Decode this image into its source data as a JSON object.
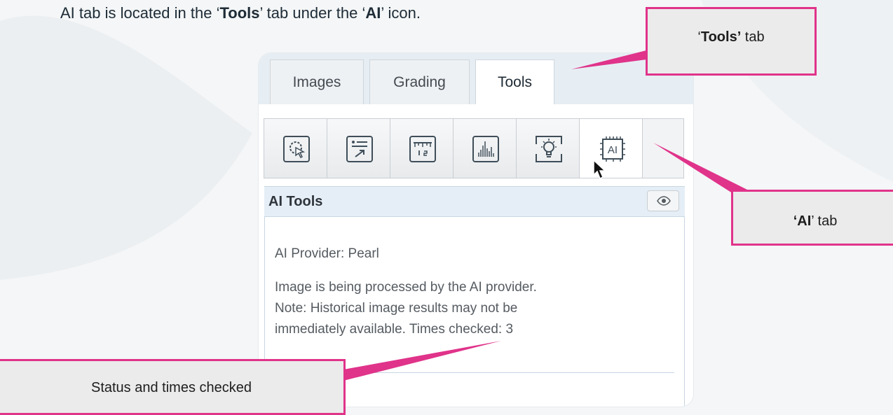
{
  "heading": {
    "prefix": "AI tab is located in the ‘",
    "tools_word": "Tools",
    "middle": "’ tab under the ‘",
    "ai_word": "AI",
    "suffix": "’ icon."
  },
  "tabs": [
    {
      "label": "Images",
      "active": false
    },
    {
      "label": "Grading",
      "active": false
    },
    {
      "label": "Tools",
      "active": true
    }
  ],
  "toolbar": {
    "tools": [
      {
        "icon": "cursor-select-icon",
        "active": false
      },
      {
        "icon": "list-export-icon",
        "active": false
      },
      {
        "icon": "ruler-measure-icon",
        "active": false
      },
      {
        "icon": "histogram-icon",
        "active": false
      },
      {
        "icon": "lightbulb-icon",
        "active": false
      },
      {
        "icon": "ai-chip-icon",
        "label": "AI",
        "active": true
      }
    ]
  },
  "ai_section": {
    "title": "AI Tools",
    "visibility_icon": "eye-icon",
    "provider_text": "AI Provider: Pearl",
    "status_lines": [
      "Image is being processed by the AI provider.",
      "Note: Historical image results may not be",
      "immediately available. Times checked: 3"
    ]
  },
  "callouts": {
    "tools_tab": {
      "open_quote": "‘",
      "bold": "Tools’",
      "rest": " tab"
    },
    "ai_tab": {
      "bold": "‘AI",
      "rest": "’ tab"
    },
    "status": {
      "text": "Status and times checked"
    }
  },
  "colors": {
    "callout_border": "#e0338a",
    "callout_fill": "#ebebeb",
    "section_header": "#e5eef6",
    "tabstrip": "#e6eef4"
  }
}
